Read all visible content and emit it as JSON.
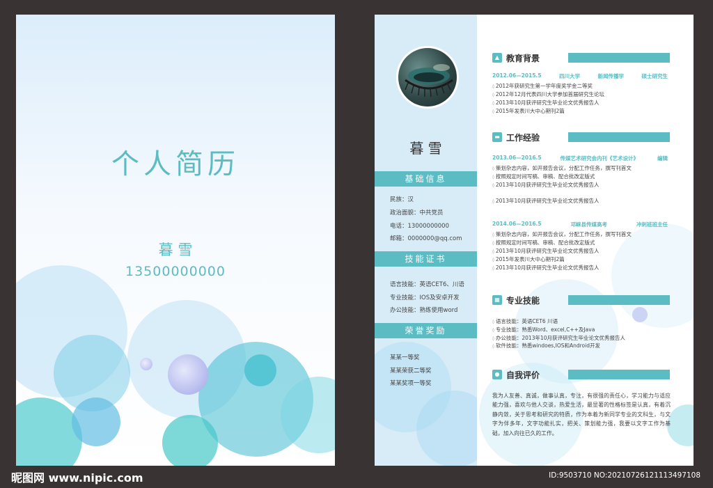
{
  "cover": {
    "title": "个人简历",
    "name": "暮 雪",
    "phone": "13500000000"
  },
  "sidebar": {
    "name": "暮 雪",
    "basic_header": "基础信息",
    "basic": [
      "民族：汉",
      "政治面貌：中共党员",
      "电话：13000000000",
      "邮箱：0000000@qq.com"
    ],
    "cert_header": "技能证书",
    "certs": [
      "语言技能：英语CET6、川语",
      "专业技能：IOS及安卓开发",
      "办公技能：熟练使用word"
    ],
    "honor_header": "荣誉奖励",
    "honors": [
      "某某一等奖",
      "某某荣获二等奖",
      "某某奖项一等奖"
    ]
  },
  "education": {
    "title": "教育背景",
    "entry": {
      "period": "2012.06—2015.5",
      "school": "四川大学",
      "major": "新闻传播学",
      "degree": "硕士研究生"
    },
    "items": [
      "2012年获研究生第一学年度奖学金二等奖",
      "2012年12月代表四川大学参加首届研究生论坛",
      "2013年10月获评研究生毕业论文优秀报告人",
      "2015年发表川大中心期刊2篇"
    ]
  },
  "work": {
    "title": "工作经验",
    "jobs": [
      {
        "period": "2013.06—2016.5",
        "org": "传媒艺术研究会内刊《艺术设计》",
        "role": "编辑",
        "items": [
          "策划杂志内容，如开报告会议，分配工作任务，撰写刊首文",
          "按照规定时间写稿、审稿、配合批改定版式",
          "2013年10月获评研究生毕业论文优秀报告人",
          "2013年10月获评研究生毕业论文优秀报告人"
        ]
      },
      {
        "period": "2014.06—2016.5",
        "org": "邛崃县传媒高考",
        "role": "冲刺班班主任",
        "items": [
          "策划杂志内容，如开报告会议，分配工作任务，撰写刊首文",
          "按照规定时间写稿、审稿、配合批改定版式",
          "2013年10月获评研究生毕业论文优秀报告人",
          "2015年发表川大中心期刊2篇",
          "2013年10月获评研究生毕业论文优秀报告人"
        ]
      }
    ]
  },
  "skills": {
    "title": "专业技能",
    "items": [
      "语言技能：英语CET6  川语",
      "专业技能：熟悉Word、excel,C++及Java",
      "办公技能：2013年10月获评研究生毕业论文优秀报告人",
      "软件技能：熟悉windoes,IOS和Android开发"
    ]
  },
  "self_eval": {
    "title": "自我评价",
    "text": "我为人友善、真诚，做事认真，专注，有很强的责任心，学习能力与适应能力强，喜欢与他人交谈，热爱生活，最显著的性格标签是认真，有着沉静内敛，关于思考和研究的特质，作为本着为新同学专业的文科生，与文字为伴多年，文字功能扎实，把关、策划能力强，我要以文字工作为基础，加入向往已久的工作。"
  },
  "watermark": {
    "left": "昵图网 www.nipic.com",
    "right": "ID:9503710 NO:20210726121113497108"
  },
  "colors": {
    "accent": "#5bbcc3",
    "sidebar": "#d8ecf8",
    "frame": "#3a3334"
  }
}
